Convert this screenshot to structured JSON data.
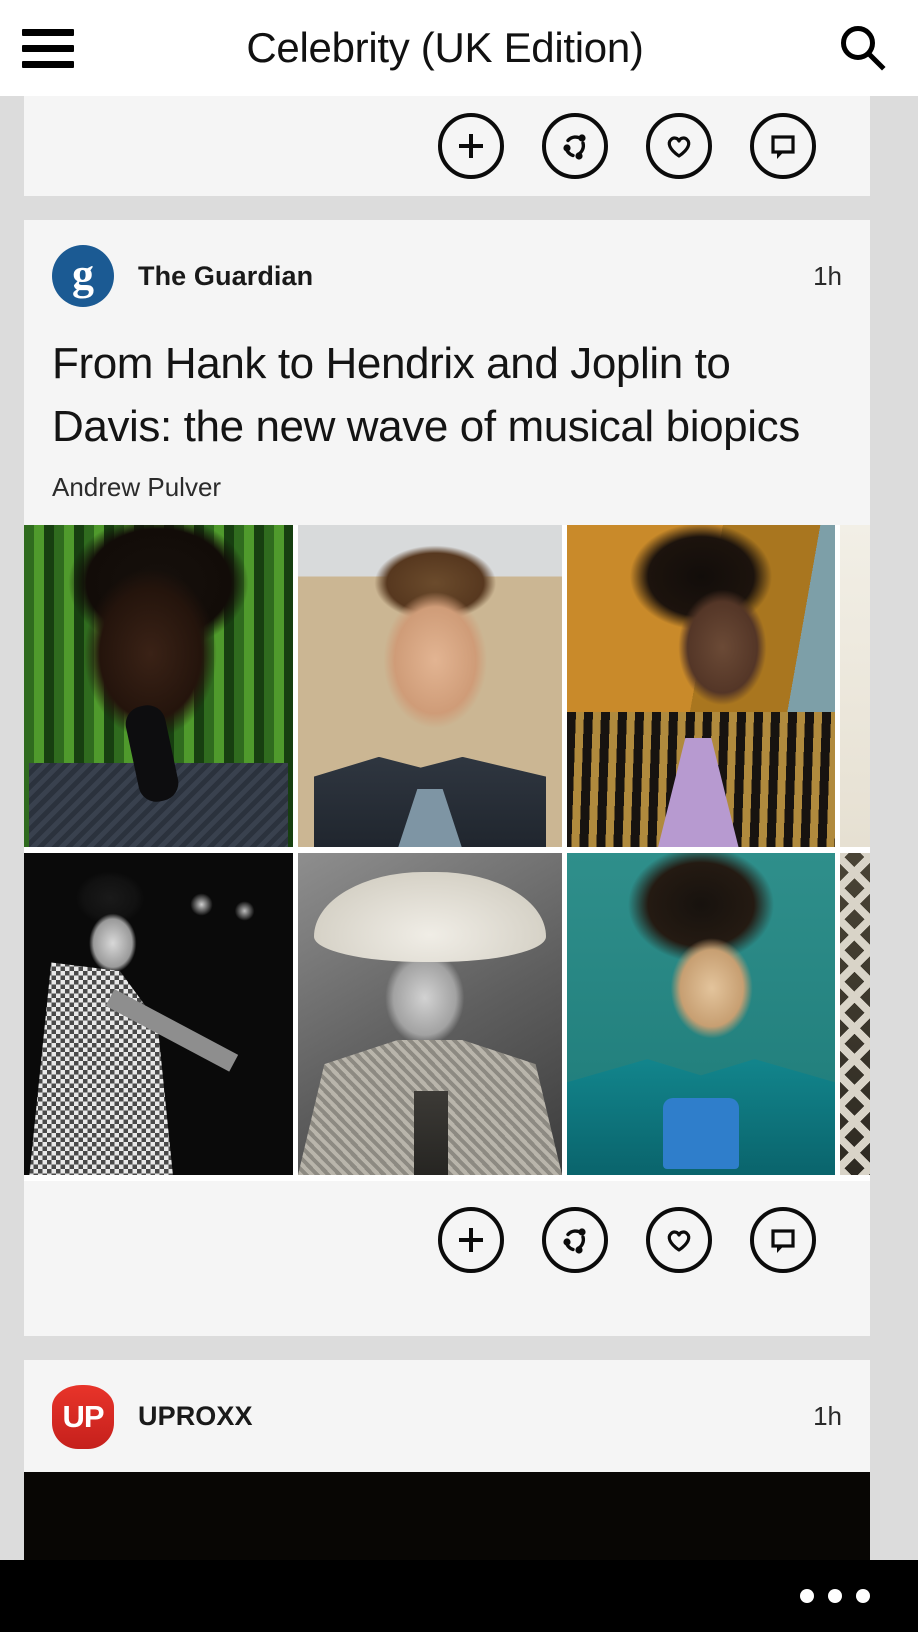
{
  "appbar": {
    "menu_icon": "hamburger-menu-icon",
    "title": "Celebrity (UK Edition)",
    "search_icon": "search-icon"
  },
  "actions": {
    "add_icon": "plus-circle-icon",
    "share_icon": "share-circle-icon",
    "like_icon": "heart-circle-icon",
    "comment_icon": "comment-circle-icon"
  },
  "cards": [
    {
      "id": "partial-top-card",
      "note": "partially scrolled-off card showing only its action bar"
    },
    {
      "id": "guardian-card",
      "source": "The Guardian",
      "source_logo": "guardian-g-logo",
      "time": "1h",
      "headline": "From Hank to Hendrix and Joplin to Davis: the new wave of musical biopics",
      "byline": "Andrew Pulver",
      "photos": [
        {
          "name": "james-brown-color-photo",
          "alt": "James Brown singing in front of green curtain"
        },
        {
          "name": "tom-hiddleston-photo",
          "alt": "Tom Hiddleston portrait in beige room"
        },
        {
          "name": "andre-3000-hendrix-photo",
          "alt": "Andre 3000 as Jimi Hendrix in striped jacket"
        },
        {
          "name": "partial-photo-top",
          "alt": "partially visible fourth photo"
        },
        {
          "name": "james-brown-bw-photo",
          "alt": "Black and white James Brown on stage with microphone"
        },
        {
          "name": "hank-williams-bw-photo",
          "alt": "Black and white Hank Williams wearing cowboy hat"
        },
        {
          "name": "jimi-hendrix-teal-photo",
          "alt": "Jimi Hendrix in teal jacket and blue scarf"
        },
        {
          "name": "lattice-fence-photo",
          "alt": "partially visible lattice fence photo"
        }
      ]
    },
    {
      "id": "uproxx-card",
      "source": "UPROXX",
      "source_logo": "uproxx-up-logo",
      "logo_text": "UP",
      "time": "1h"
    }
  ],
  "bottombar": {
    "overflow_icon": "overflow-dots-icon"
  },
  "colors": {
    "page_background": "#dcdcdc",
    "card_background": "#f5f5f5",
    "appbar_background": "#ffffff",
    "guardian_blue": "#1b5a93",
    "uproxx_red": "#e8342a",
    "bottombar_black": "#000000",
    "text_primary": "#141414"
  }
}
